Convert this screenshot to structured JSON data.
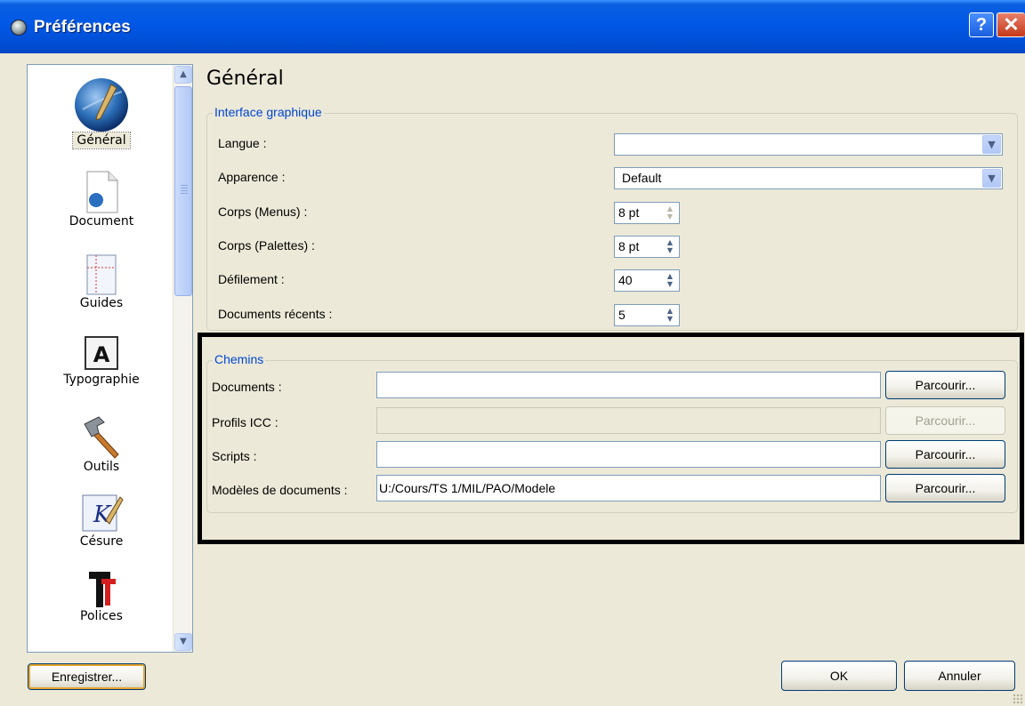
{
  "window": {
    "title": "Préférences",
    "help_button": "?",
    "close_button": "✕"
  },
  "nav": {
    "items": [
      {
        "label": "Général",
        "icon": "pen-globe-icon",
        "selected": true
      },
      {
        "label": "Document",
        "icon": "document-icon"
      },
      {
        "label": "Guides",
        "icon": "guides-icon"
      },
      {
        "label": "Typographie",
        "icon": "typography-icon",
        "glyph": "A"
      },
      {
        "label": "Outils",
        "icon": "hammer-icon"
      },
      {
        "label": "Césure",
        "icon": "hyphenation-icon"
      },
      {
        "label": "Polices",
        "icon": "fonts-icon"
      }
    ]
  },
  "main": {
    "title": "Général",
    "interface": {
      "legend": "Interface graphique",
      "langue_label": "Langue :",
      "langue_value": "",
      "apparence_label": "Apparence :",
      "apparence_value": "Default",
      "corps_menus_label": "Corps (Menus) :",
      "corps_menus_value": "8 pt",
      "corps_palettes_label": "Corps (Palettes) :",
      "corps_palettes_value": "8 pt",
      "defilement_label": "Défilement :",
      "defilement_value": "40",
      "recents_label": "Documents récents :",
      "recents_value": "5"
    },
    "chemins": {
      "legend": "Chemins",
      "rows": [
        {
          "label": "Documents :",
          "value": "",
          "button": "Parcourir...",
          "enabled": true
        },
        {
          "label": "Profils ICC :",
          "value": "",
          "button": "Parcourir...",
          "enabled": false
        },
        {
          "label": "Scripts :",
          "value": "",
          "button": "Parcourir...",
          "enabled": true
        },
        {
          "label": "Modèles de documents :",
          "value": "U:/Cours/TS 1/MIL/PAO/Modele",
          "button": "Parcourir...",
          "enabled": true
        }
      ]
    }
  },
  "footer": {
    "save_label": "Enregistrer...",
    "ok_label": "OK",
    "cancel_label": "Annuler"
  },
  "colors": {
    "titlebar": "#0058e6",
    "legend": "#0046d5",
    "dialog_bg": "#ece9d8"
  }
}
